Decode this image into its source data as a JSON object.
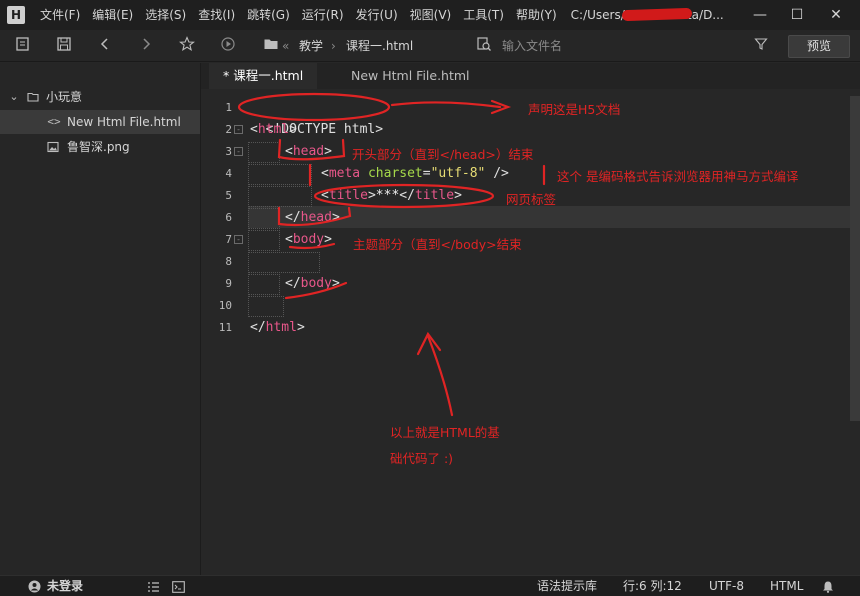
{
  "app": {
    "logo_letter": "H"
  },
  "menu": {
    "items": [
      "文件(F)",
      "编辑(E)",
      "选择(S)",
      "查找(I)",
      "跳转(G)",
      "运行(R)",
      "发行(U)",
      "视图(V)",
      "工具(T)",
      "帮助(Y)"
    ],
    "path": "C:/Users/A         ta/D..."
  },
  "window": {
    "minimize": "—",
    "maximize": "☐",
    "close": "✕"
  },
  "toolbar": {
    "breadcrumb_sep": "«",
    "crumb_1": "教学",
    "crumb_arrow": "›",
    "crumb_2": "课程一.html",
    "search_placeholder": "输入文件名",
    "preview_label": "预览"
  },
  "sidebar": {
    "project": "小玩意",
    "files": [
      {
        "icon": "<>",
        "name": "New Html File.html",
        "selected": true
      },
      {
        "icon": "img",
        "name": "鲁智深.png",
        "selected": false
      }
    ]
  },
  "tabs": [
    {
      "label": "* 课程一.html",
      "active": true
    },
    {
      "label": "New Html File.html",
      "active": false
    }
  ],
  "editor": {
    "line_numbers": [
      "1",
      "2",
      "3",
      "4",
      "5",
      "6",
      "7",
      "8",
      "9",
      "10",
      "11"
    ],
    "lines": {
      "l1": {
        "doctype": "<!DOCTYPE html>"
      },
      "l2": {
        "open": "<",
        "tag": "html",
        "close": ">"
      },
      "l3": {
        "open": "<",
        "tag": "head",
        "close": ">"
      },
      "l4": {
        "open": "<",
        "tag": "meta",
        "attr": "charset",
        "eq": "=",
        "value": "\"utf-8\"",
        "close": " />"
      },
      "l5": {
        "open": "<",
        "tag": "title",
        "mid": ">",
        "text": "***",
        "open2": "</",
        "tag2": "title",
        "close": ">"
      },
      "l6": {
        "open": "</",
        "tag": "head",
        "close": ">"
      },
      "l7": {
        "open": "<",
        "tag": "body",
        "close": ">"
      },
      "l9": {
        "open": "</",
        "tag": "body",
        "close": ">"
      },
      "l11": {
        "open": "</",
        "tag": "html",
        "close": ">"
      }
    }
  },
  "annotations": {
    "doctype_note": "声明这是H5文档",
    "head_note": "开头部分（直到</head>）结束",
    "meta_note": "这个 是编码格式告诉浏览器用神马方式编译",
    "title_note": "网页标签",
    "body_note": "主题部分（直到</body>结束",
    "summary_line1": "以上就是HTML的基",
    "summary_line2": "础代码了 :)"
  },
  "status": {
    "login": "未登录",
    "syntax_hint": "语法提示库",
    "cursor": "行:6  列:12",
    "encoding": "UTF-8",
    "language": "HTML"
  },
  "colors": {
    "annotation_red": "#e02424",
    "tag_pink": "#e8578a",
    "attr_green": "#a6d94a",
    "string_yellow": "#e6db74"
  }
}
